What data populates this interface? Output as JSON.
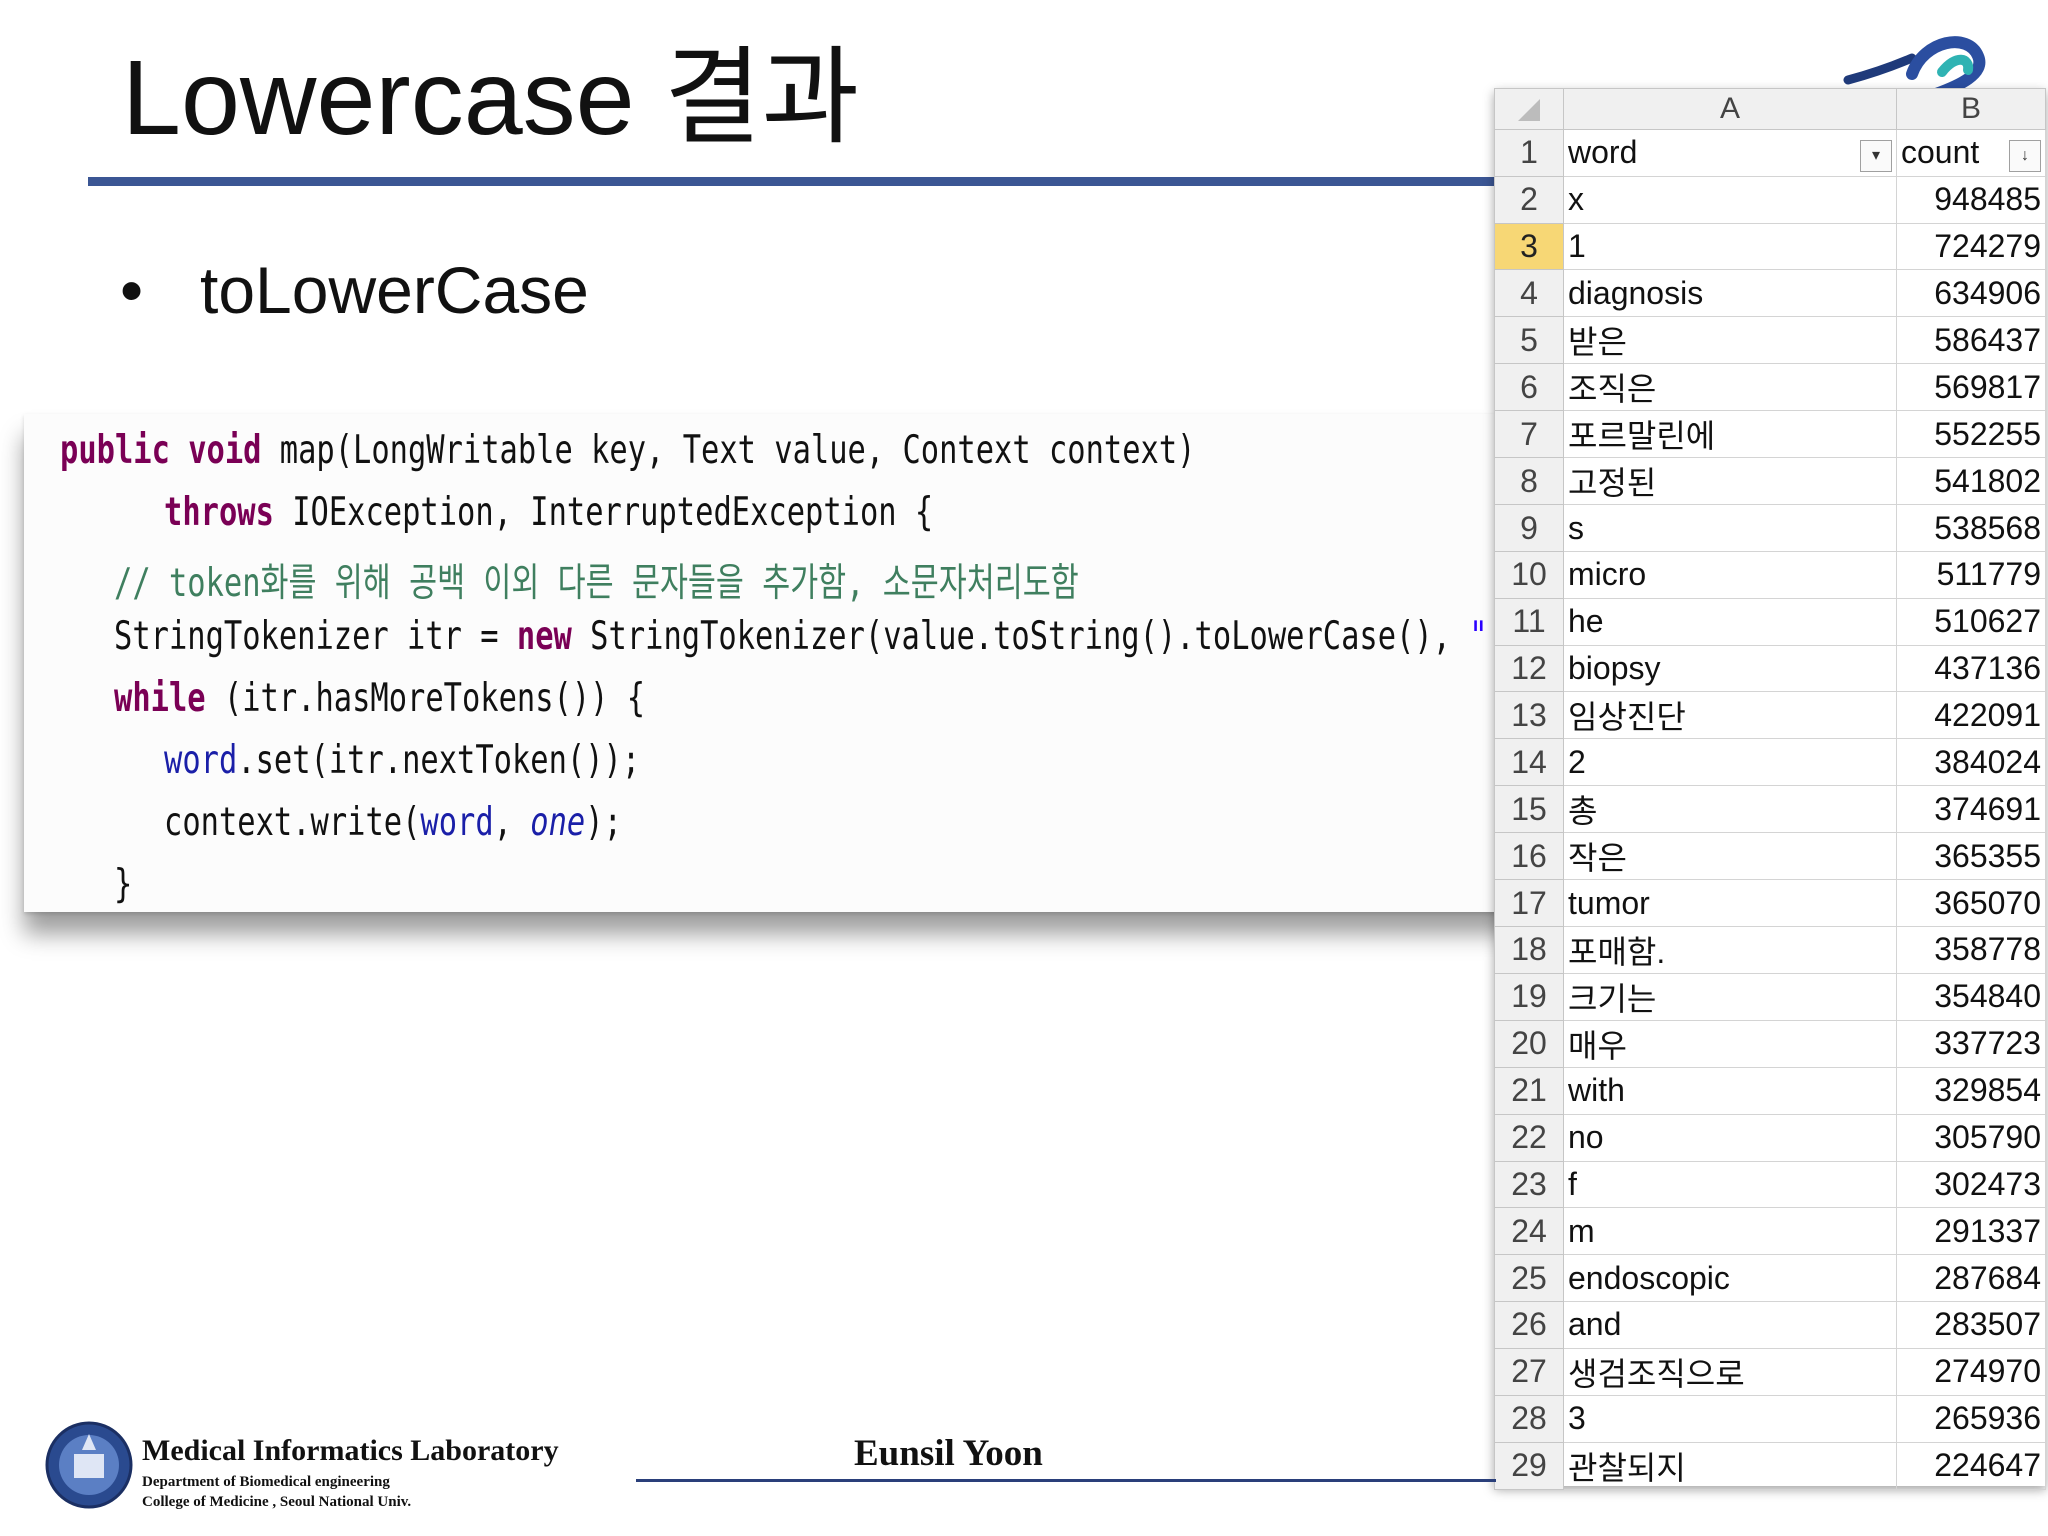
{
  "slide": {
    "title": "Lowercase 결과",
    "bullet": "toLowerCase",
    "bullet_marker": "•"
  },
  "code": {
    "line1": {
      "kw": "public void",
      "rest": " map(LongWritable key, Text value, Context context)"
    },
    "line2": {
      "kw": "throws",
      "rest": " IOException, InterruptedException {"
    },
    "line3": {
      "comment": "// token화를 위해 공백 이외 다른 문자들을 추가함, 소문자처리도함"
    },
    "line4": {
      "pre": "StringTokenizer itr = ",
      "kw": "new",
      "mid": " StringTokenizer(value.toString().toLowerCase(), ",
      "str": "\" ,:;/-!?()'\\\"   \"",
      "end": ")"
    },
    "line5": {
      "kw": "while",
      "rest": " (itr.hasMoreTokens()) {"
    },
    "line6": {
      "field": "word",
      "rest": ".set(itr.nextToken());"
    },
    "line7": {
      "pre": "context.write(",
      "field": "word",
      "sep": ", ",
      "italic": "one",
      "end": ");"
    },
    "line8": {
      "brace": "}"
    }
  },
  "sheet": {
    "col_a": "A",
    "col_b": "B",
    "header_word": "word",
    "header_count": "count",
    "filter_icon_a": "▾",
    "filter_icon_b": "↓",
    "rows": [
      {
        "n": "2",
        "word": "x",
        "count": "948485"
      },
      {
        "n": "3",
        "word": "1",
        "count": "724279"
      },
      {
        "n": "4",
        "word": "diagnosis",
        "count": "634906"
      },
      {
        "n": "5",
        "word": "받은",
        "count": "586437"
      },
      {
        "n": "6",
        "word": "조직은",
        "count": "569817"
      },
      {
        "n": "7",
        "word": "포르말린에",
        "count": "552255"
      },
      {
        "n": "8",
        "word": "고정된",
        "count": "541802"
      },
      {
        "n": "9",
        "word": "s",
        "count": "538568"
      },
      {
        "n": "10",
        "word": "micro",
        "count": "511779"
      },
      {
        "n": "11",
        "word": "he",
        "count": "510627"
      },
      {
        "n": "12",
        "word": "biopsy",
        "count": "437136"
      },
      {
        "n": "13",
        "word": "임상진단",
        "count": "422091"
      },
      {
        "n": "14",
        "word": "2",
        "count": "384024"
      },
      {
        "n": "15",
        "word": "총",
        "count": "374691"
      },
      {
        "n": "16",
        "word": "작은",
        "count": "365355"
      },
      {
        "n": "17",
        "word": "tumor",
        "count": "365070"
      },
      {
        "n": "18",
        "word": "포매함.",
        "count": "358778"
      },
      {
        "n": "19",
        "word": "크기는",
        "count": "354840"
      },
      {
        "n": "20",
        "word": "매우",
        "count": "337723"
      },
      {
        "n": "21",
        "word": "with",
        "count": "329854"
      },
      {
        "n": "22",
        "word": "no",
        "count": "305790"
      },
      {
        "n": "23",
        "word": "f",
        "count": "302473"
      },
      {
        "n": "24",
        "word": "m",
        "count": "291337"
      },
      {
        "n": "25",
        "word": "endoscopic",
        "count": "287684"
      },
      {
        "n": "26",
        "word": "and",
        "count": "283507"
      },
      {
        "n": "27",
        "word": "생검조직으로",
        "count": "274970"
      },
      {
        "n": "28",
        "word": "3",
        "count": "265936"
      },
      {
        "n": "29",
        "word": "관찰되지",
        "count": "224647"
      }
    ],
    "selected_row": "3"
  },
  "footer": {
    "lab_name": "Medical  Informatics Laboratory",
    "dept": "Department of Biomedical engineering",
    "college": "College of Medicine , Seoul  National  Univ.",
    "author": "Eunsil Yoon"
  },
  "colors": {
    "title_rule": "#3b5694",
    "keyword": "#7a0055",
    "comment": "#3f7f5f",
    "field": "#1a1fa8",
    "selected_row_header": "#f7d775"
  }
}
